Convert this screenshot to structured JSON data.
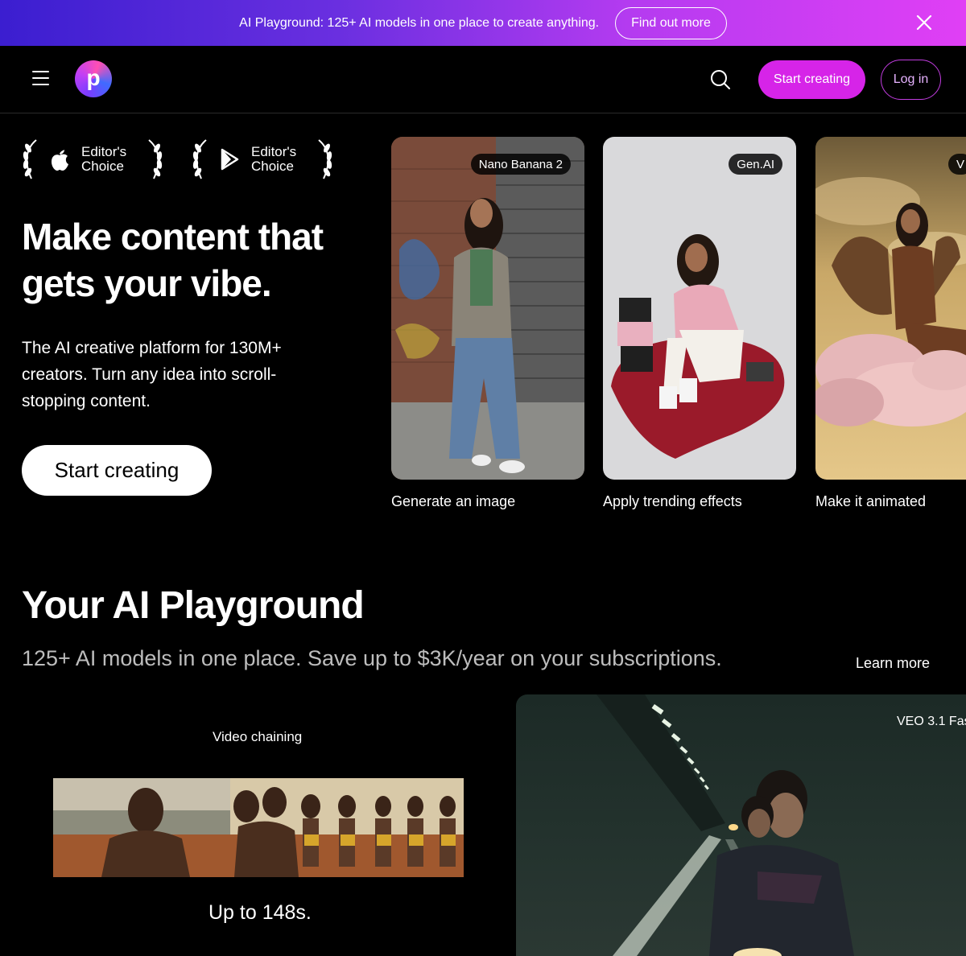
{
  "banner": {
    "text": "AI Playground: 125+ AI models in one place to create anything.",
    "button_label": "Find out more"
  },
  "header": {
    "logo_letter": "p",
    "start_label": "Start creating",
    "login_label": "Log in"
  },
  "awards": [
    {
      "store": "apple-icon",
      "text": "Editor's Choice"
    },
    {
      "store": "google-play-icon",
      "text": "Editor's Choice"
    }
  ],
  "hero": {
    "title": "Make content that gets your vibe.",
    "subtitle": "The AI creative platform for 130M+ creators. Turn any idea into scroll-stopping content.",
    "cta_label": "Start creating"
  },
  "cards": [
    {
      "badge": "Nano Banana 2",
      "caption": "Generate an image"
    },
    {
      "badge": "Gen.AI",
      "caption": "Apply trending effects"
    },
    {
      "badge": "V",
      "caption": "Make it animated"
    }
  ],
  "playground": {
    "title": "Your AI Playground",
    "subtitle": "125+ AI models in one place. Save up to $3K/year on your subscriptions.",
    "learn_more": "Learn more",
    "video_chaining_label": "Video chaining",
    "video_chaining_caption": "Up to 148s.",
    "veo_label": "VEO 3.1 Fas"
  },
  "colors": {
    "accent": "#d624e8",
    "banner_start": "#3b1ed0",
    "banner_end": "#e03ff5",
    "background": "#000000"
  }
}
